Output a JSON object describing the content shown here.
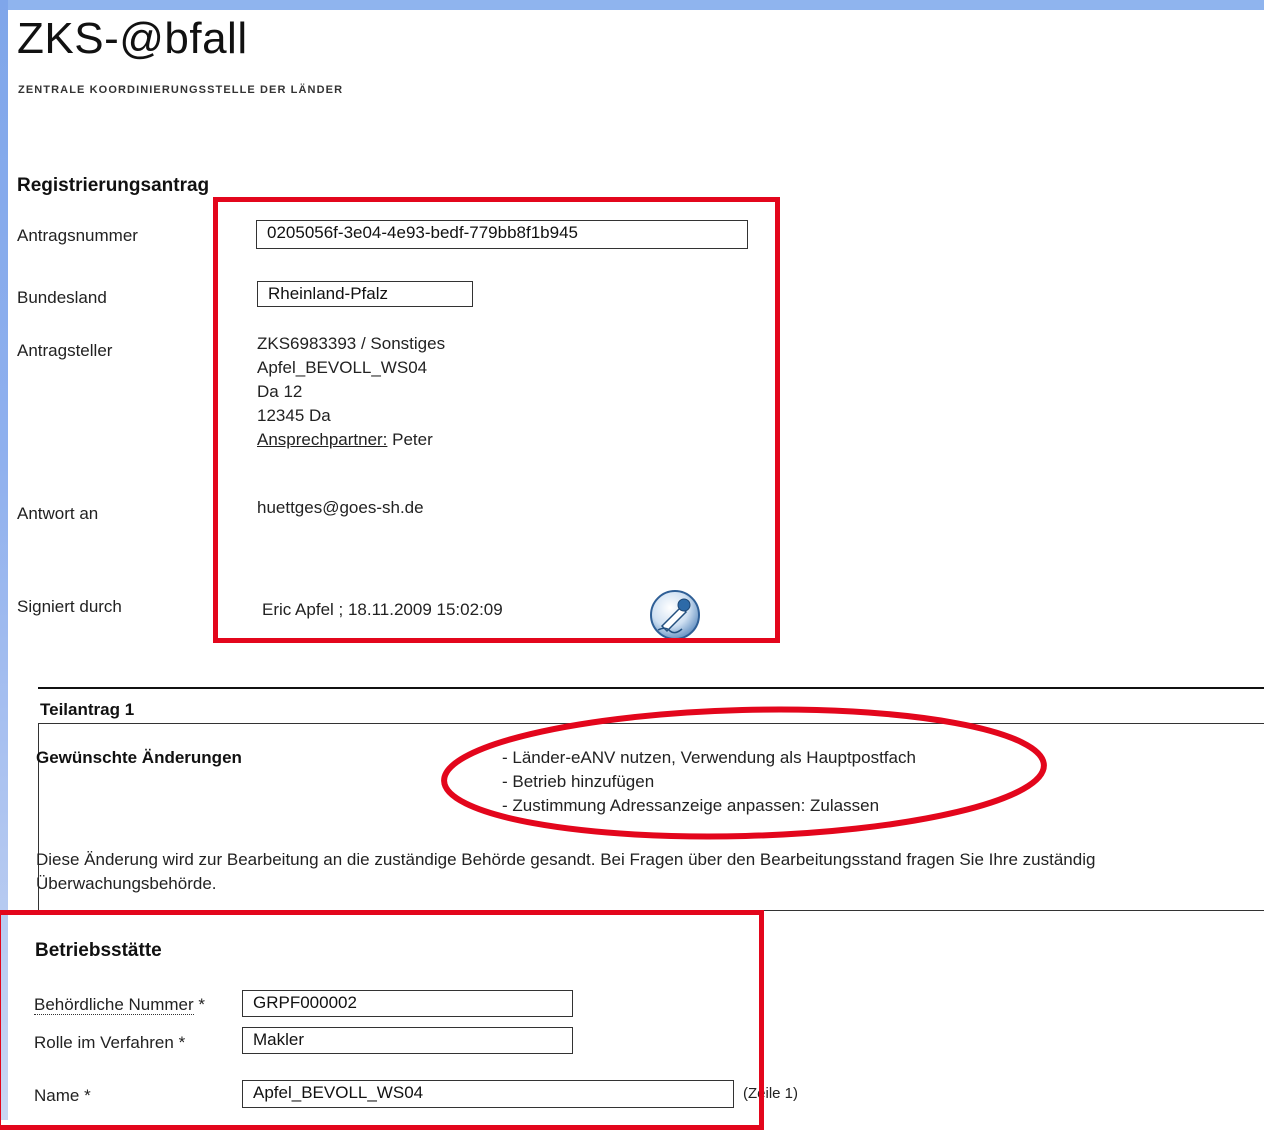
{
  "header": {
    "logo_text": "ZKS-@bfall",
    "logo_subtitle": "ZENTRALE KOORDINIERUNGSSTELLE DER LÄNDER"
  },
  "registrierungsantrag": {
    "heading": "Registrierungsantrag",
    "antragsnummer_label": "Antragsnummer",
    "antragsnummer_value": "0205056f-3e04-4e93-bedf-779bb8f1b945",
    "bundesland_label": "Bundesland",
    "bundesland_value": "Rheinland-Pfalz",
    "antragsteller_label": "Antragsteller",
    "antragsteller_lines": [
      "ZKS6983393 / Sonstiges",
      "Apfel_BEVOLL_WS04",
      "Da 12",
      "12345 Da"
    ],
    "ansprechpartner_label": "Ansprechpartner:",
    "ansprechpartner_value": " Peter",
    "antwort_label": "Antwort an",
    "antwort_value": "huettges@goes-sh.de",
    "signiert_label": "Signiert durch",
    "signiert_value": "Eric Apfel ; 18.11.2009 15:02:09",
    "signature_icon": "signature-pen-icon"
  },
  "teilantrag": {
    "heading": "Teilantrag 1",
    "changes_label": "Gewünschte Änderungen",
    "changes": [
      "- Länder-eANV nutzen, Verwendung als Hauptpostfach",
      "- Betrieb hinzufügen",
      "- Zustimmung Adressanzeige anpassen: Zulassen"
    ],
    "note_line1": "Diese Änderung wird zur Bearbeitung an die zuständige Behörde gesandt. Bei Fragen über den Bearbeitungsstand fragen Sie Ihre zuständig",
    "note_line2": "Überwachungsbehörde."
  },
  "betriebsstaette": {
    "heading": "Betriebsstätte",
    "behoerdliche_nummer_label": "Behördliche Nummer",
    "behoerdliche_nummer_star": " *",
    "behoerdliche_nummer_value": "GRPF000002",
    "rolle_label": "Rolle im Verfahren *",
    "rolle_value": "Makler",
    "name_label": "Name *",
    "name_value": "Apfel_BEVOLL_WS04",
    "zeile_hint": "(Zeile 1)"
  },
  "colors": {
    "highlight_red": "#e3061c",
    "frame_blue": "#8fb4ee"
  }
}
